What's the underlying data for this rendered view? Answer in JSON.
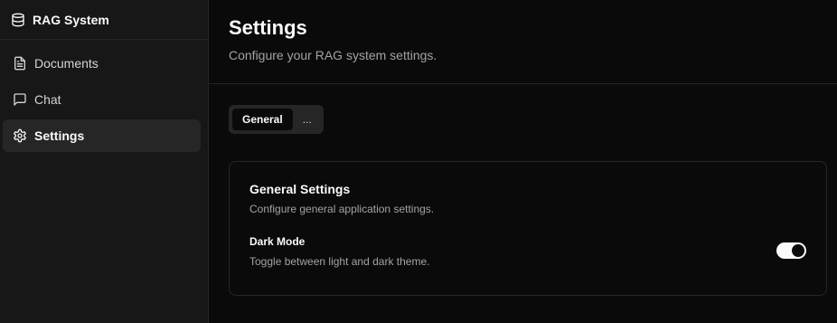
{
  "sidebar": {
    "brand": {
      "title": "RAG System",
      "icon": "database-icon"
    },
    "items": [
      {
        "label": "Documents",
        "icon": "document-icon",
        "active": false
      },
      {
        "label": "Chat",
        "icon": "chat-icon",
        "active": false
      },
      {
        "label": "Settings",
        "icon": "gear-icon",
        "active": true
      }
    ]
  },
  "header": {
    "title": "Settings",
    "subtitle": "Configure your RAG system settings."
  },
  "tabs": [
    {
      "label": "General",
      "active": true
    },
    {
      "label": "...",
      "active": false
    }
  ],
  "card": {
    "title": "General Settings",
    "description": "Configure general application settings.",
    "settings": [
      {
        "label": "Dark Mode",
        "description": "Toggle between light and dark theme.",
        "enabled": true
      }
    ]
  },
  "colors": {
    "background": "#0a0a0a",
    "sidebar": "#171717",
    "active_item": "#262626",
    "text": "#fafafa",
    "muted_text": "#a3a3a3"
  }
}
